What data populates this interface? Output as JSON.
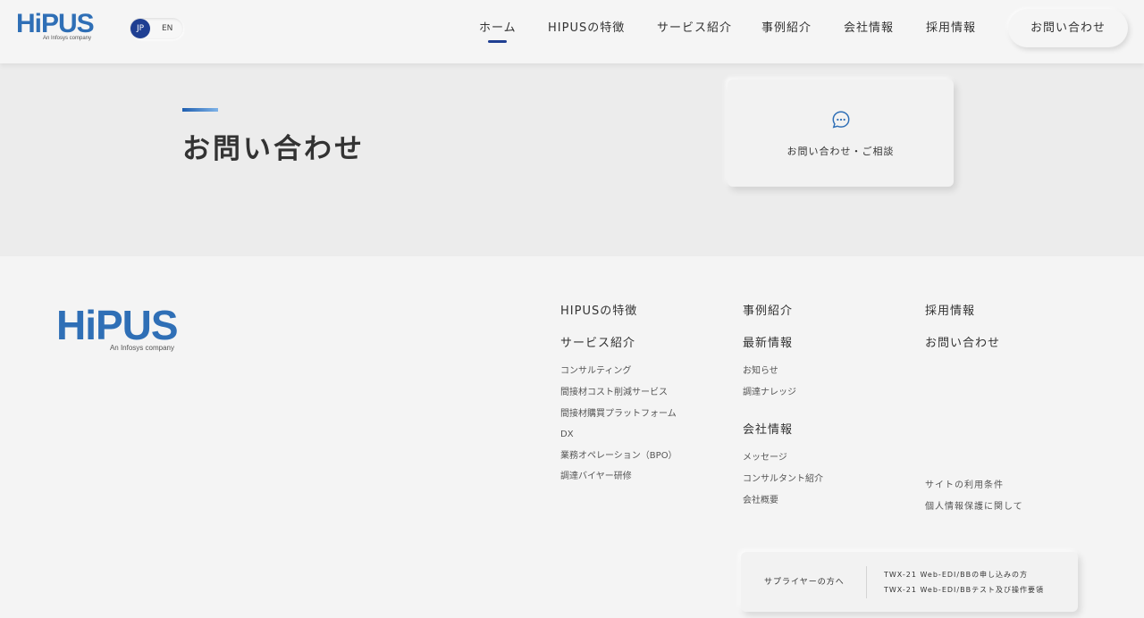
{
  "header": {
    "logo_text": "HiPUS",
    "logo_sub": "An Infosys company",
    "lang": {
      "jp": "JP",
      "en": "EN"
    },
    "nav": [
      {
        "label": "ホーム",
        "active": true
      },
      {
        "label": "HIPUSの特徴"
      },
      {
        "label": "サービス紹介"
      },
      {
        "label": "事例紹介"
      },
      {
        "label": "会社情報"
      },
      {
        "label": "採用情報"
      }
    ],
    "contact_button": "お問い合わせ"
  },
  "hero": {
    "title": "お問い合わせ",
    "card_label": "お問い合わせ・ご相談",
    "card_icon": "chat-bubble-icon"
  },
  "footer": {
    "logo_text": "HiPUS",
    "logo_sub": "An Infosys company",
    "col1": {
      "heading1": "HIPUSの特徴",
      "heading2": "サービス紹介",
      "links": [
        "コンサルティング",
        "間接材コスト削減サービス",
        "間接材購買プラットフォーム",
        "DX",
        "業務オペレーション（BPO）",
        "調達バイヤー研修"
      ]
    },
    "col2": {
      "heading1": "事例紹介",
      "heading2": "最新情報",
      "links1": [
        "お知らせ",
        "調達ナレッジ"
      ],
      "heading3": "会社情報",
      "links2": [
        "メッセージ",
        "コンサルタント紹介",
        "会社概要"
      ]
    },
    "col3": {
      "heading1": "採用情報",
      "heading2": "お問い合わせ",
      "links": [
        "サイトの利用条件",
        "個人情報保護に関して"
      ]
    },
    "supplier": {
      "title": "サプライヤーの方へ",
      "links": [
        "TWX-21 Web-EDI/BBの申し込みの方",
        "TWX-21 Web-EDI/BBテスト及び操作要領"
      ]
    }
  },
  "colors": {
    "brand_blue": "#2f6fb6",
    "navy": "#1f3f92"
  }
}
